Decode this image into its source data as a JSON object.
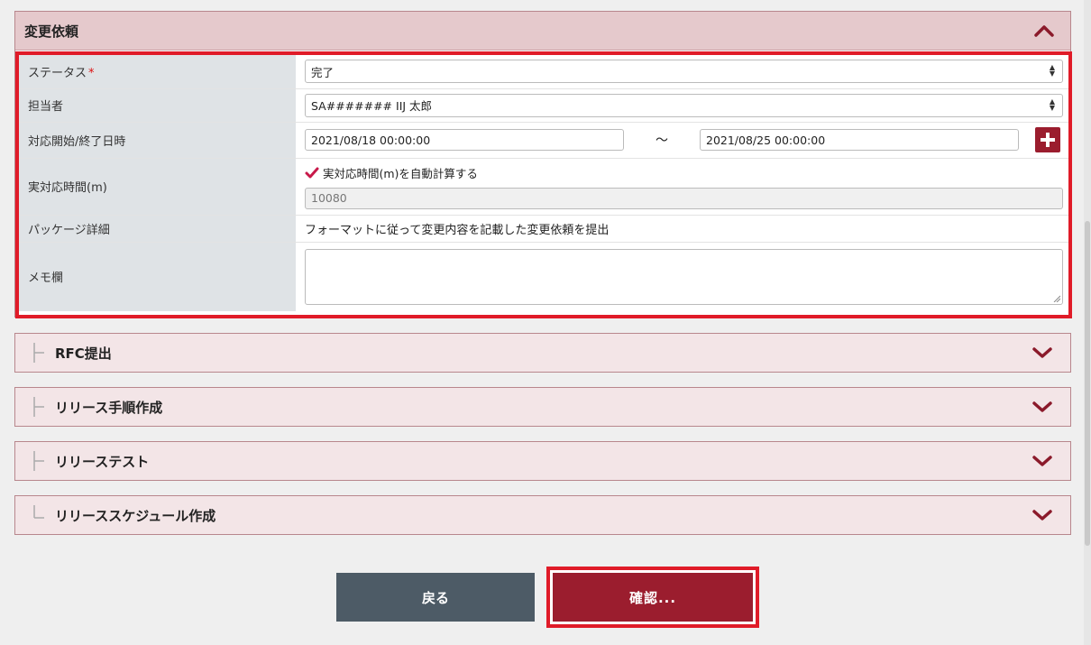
{
  "section_open": {
    "title": "変更依頼",
    "fields": {
      "status": {
        "label": "ステータス",
        "required_mark": "*",
        "value": "完了"
      },
      "assignee": {
        "label": "担当者",
        "value": "SA####### IIJ 太郎"
      },
      "period": {
        "label": "対応開始/終了日時",
        "start": "2021/08/18 00:00:00",
        "separator": "～",
        "end": "2021/08/25 00:00:00"
      },
      "actual_time": {
        "label": "実対応時間(m)",
        "auto_calc_label": "実対応時間(m)を自動計算する",
        "auto_calc_checked": true,
        "value": "10080"
      },
      "package_detail": {
        "label": "パッケージ詳細",
        "value": "フォーマットに従って変更内容を記載した変更依頼を提出"
      },
      "memo": {
        "label": "メモ欄",
        "value": ""
      }
    }
  },
  "sections_collapsed": [
    {
      "title": "RFC提出"
    },
    {
      "title": "リリース手順作成"
    },
    {
      "title": "リリーステスト"
    },
    {
      "title": "リリーススケジュール作成"
    }
  ],
  "buttons": {
    "back": "戻る",
    "confirm": "確認..."
  },
  "colors": {
    "accent": "#9b1d2e",
    "highlight": "#e01b28",
    "back_button": "#4d5b66"
  }
}
